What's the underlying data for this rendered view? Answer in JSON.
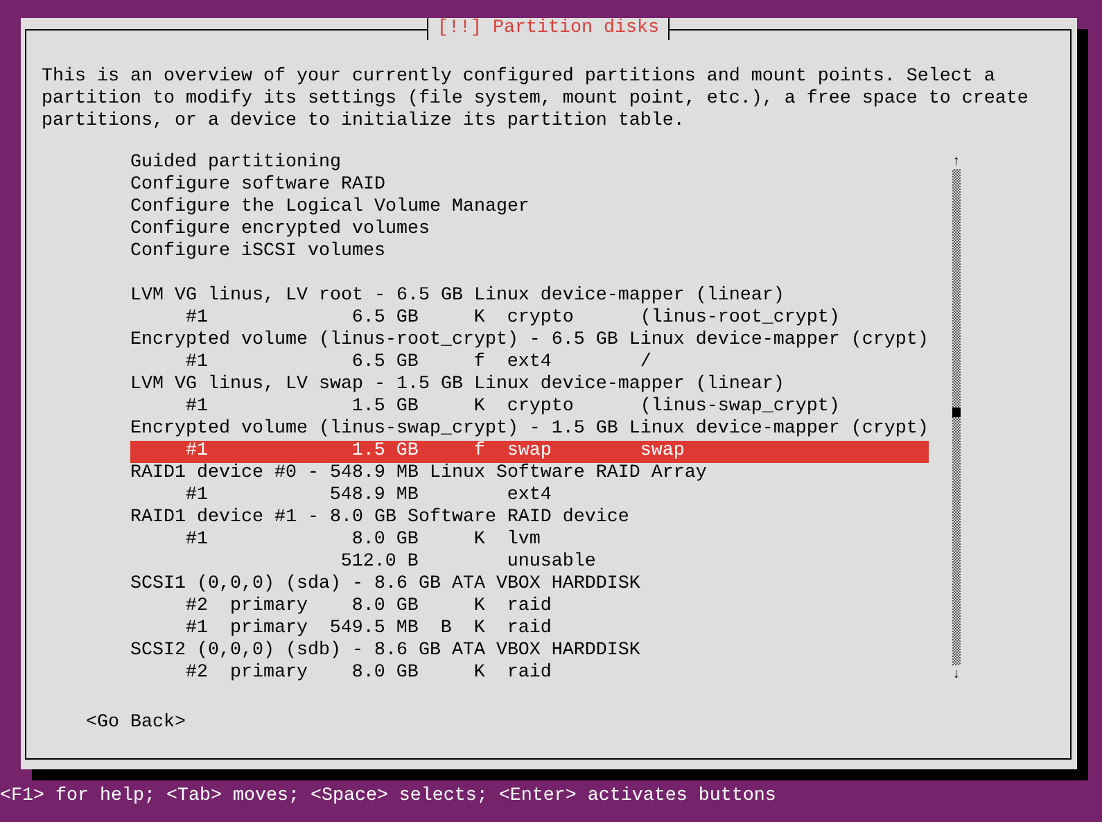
{
  "dialog": {
    "title": "[!!] Partition disks",
    "description": "This is an overview of your currently configured partitions and mount points. Select a partition to modify its settings (file system, mount point, etc.), a free space to create partitions, or a device to initialize its partition table.",
    "list": [
      {
        "kind": "option",
        "text": "Guided partitioning",
        "selected": false
      },
      {
        "kind": "option",
        "text": "Configure software RAID",
        "selected": false
      },
      {
        "kind": "option",
        "text": "Configure the Logical Volume Manager",
        "selected": false
      },
      {
        "kind": "option",
        "text": "Configure encrypted volumes",
        "selected": false
      },
      {
        "kind": "option",
        "text": "Configure iSCSI volumes",
        "selected": false
      },
      {
        "kind": "separator",
        "selected": false
      },
      {
        "kind": "device",
        "text": "LVM VG linus, LV root - 6.5 GB Linux device-mapper (linear)",
        "selected": false
      },
      {
        "kind": "partition",
        "number": "#1",
        "size": "6.5 GB",
        "method": "K",
        "file_system": "crypto",
        "mount": "(linus-root_crypt)",
        "selected": false
      },
      {
        "kind": "device",
        "text": "Encrypted volume (linus-root_crypt) - 6.5 GB Linux device-mapper (crypt)",
        "selected": false
      },
      {
        "kind": "partition",
        "number": "#1",
        "size": "6.5 GB",
        "method": "f",
        "file_system": "ext4",
        "mount": "/",
        "selected": false
      },
      {
        "kind": "device",
        "text": "LVM VG linus, LV swap - 1.5 GB Linux device-mapper (linear)",
        "selected": false
      },
      {
        "kind": "partition",
        "number": "#1",
        "size": "1.5 GB",
        "method": "K",
        "file_system": "crypto",
        "mount": "(linus-swap_crypt)",
        "selected": false
      },
      {
        "kind": "device",
        "text": "Encrypted volume (linus-swap_crypt) - 1.5 GB Linux device-mapper (crypt)",
        "selected": false
      },
      {
        "kind": "partition",
        "number": "#1",
        "size": "1.5 GB",
        "method": "f",
        "file_system": "swap",
        "mount": "swap",
        "selected": true
      },
      {
        "kind": "device",
        "text": "RAID1 device #0 - 548.9 MB Linux Software RAID Array",
        "selected": false
      },
      {
        "kind": "partition",
        "number": "#1",
        "size": "548.9 MB",
        "file_system": "ext4",
        "selected": false
      },
      {
        "kind": "device",
        "text": "RAID1 device #1 - 8.0 GB Software RAID device",
        "selected": false
      },
      {
        "kind": "partition",
        "number": "#1",
        "size": "8.0 GB",
        "method": "K",
        "file_system": "lvm",
        "selected": false
      },
      {
        "kind": "partition",
        "size": "512.0 B",
        "file_system": "unusable",
        "selected": false
      },
      {
        "kind": "device",
        "text": "SCSI1 (0,0,0) (sda) - 8.6 GB ATA VBOX HARDDISK",
        "selected": false
      },
      {
        "kind": "partition",
        "number": "#2",
        "type": "primary",
        "size": "8.0 GB",
        "method": "K",
        "file_system": "raid",
        "selected": false
      },
      {
        "kind": "partition",
        "number": "#1",
        "type": "primary",
        "size": "549.5 MB",
        "boot": "B",
        "method": "K",
        "file_system": "raid",
        "selected": false
      },
      {
        "kind": "device",
        "text": "SCSI2 (0,0,0) (sdb) - 8.6 GB ATA VBOX HARDDISK",
        "selected": false
      },
      {
        "kind": "partition",
        "number": "#2",
        "type": "primary",
        "size": "8.0 GB",
        "method": "K",
        "file_system": "raid",
        "selected": false
      }
    ],
    "scroll_up": "↑",
    "scroll_down": "↓",
    "buttons": [
      "<Go Back>"
    ]
  },
  "status_bar": "<F1> for help; <Tab> moves; <Space> selects; <Enter> activates buttons"
}
